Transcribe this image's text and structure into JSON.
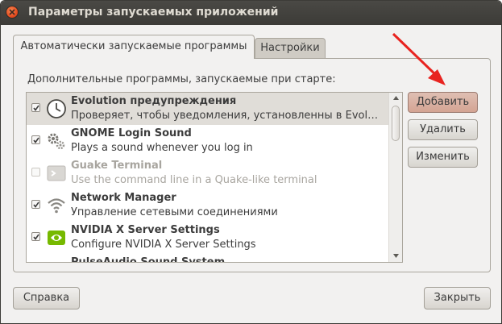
{
  "window": {
    "title": "Параметры запускаемых приложений"
  },
  "tabs": [
    {
      "label": "Автоматически запускаемые программы",
      "active": true
    },
    {
      "label": "Настройки",
      "active": false
    }
  ],
  "panel": {
    "label": "Дополнительные программы, запускаемые при старте:"
  },
  "startup_list": [
    {
      "name": "Evolution предупреждения",
      "description": "Проверяет, чтобы уведомления, установленны в Evolution",
      "checked": true,
      "enabled": true,
      "selected": true,
      "icon": "clock-icon"
    },
    {
      "name": "GNOME Login Sound",
      "description": "Plays a sound whenever you log in",
      "checked": true,
      "enabled": true,
      "selected": false,
      "icon": "gears-icon"
    },
    {
      "name": "Guake Terminal",
      "description": "Use the command line in a Quake-like terminal",
      "checked": false,
      "enabled": false,
      "selected": false,
      "icon": "terminal-icon"
    },
    {
      "name": "Network Manager",
      "description": "Управление сетевыми соединениями",
      "checked": true,
      "enabled": true,
      "selected": false,
      "icon": "wireless-icon"
    },
    {
      "name": "NVIDIA X Server Settings",
      "description": "Configure NVIDIA X Server Settings",
      "checked": true,
      "enabled": true,
      "selected": false,
      "icon": "nvidia-icon"
    },
    {
      "name": "PulseAudio Sound System",
      "description": "",
      "checked": true,
      "enabled": true,
      "selected": false,
      "icon": "speaker-icon"
    }
  ],
  "side_buttons": {
    "add": "Добавить",
    "remove": "Удалить",
    "edit": "Изменить"
  },
  "footer": {
    "help": "Справка",
    "close": "Закрыть"
  },
  "colors": {
    "titlebar": "#3c3b37",
    "close_button": "#e0461c",
    "accent_button": "#d4a493",
    "annotation_arrow": "#e8231f"
  }
}
